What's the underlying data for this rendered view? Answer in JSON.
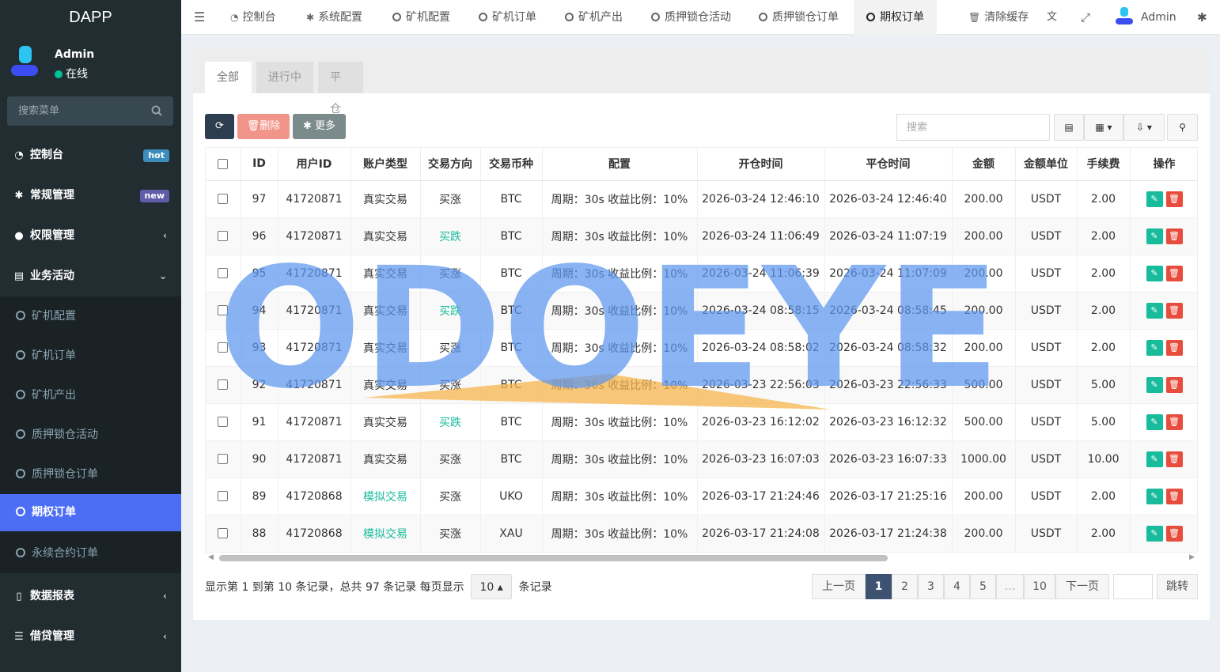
{
  "app": {
    "logo": "DAPP"
  },
  "user": {
    "name": "Admin",
    "status": "在线"
  },
  "menu_search": {
    "placeholder": "搜索菜单"
  },
  "sidebar": {
    "items": [
      {
        "label": "控制台",
        "badge": "hot",
        "badge_color": "#3c8dbc"
      },
      {
        "label": "常规管理",
        "badge": "new",
        "badge_color": "#605ca8"
      },
      {
        "label": "权限管理",
        "arrow": "‹"
      },
      {
        "label": "业务活动",
        "arrow": "⌄"
      },
      {
        "label": "数据报表",
        "arrow": "‹"
      },
      {
        "label": "借贷管理",
        "arrow": "‹"
      }
    ],
    "subitems": [
      {
        "label": "矿机配置"
      },
      {
        "label": "矿机订单"
      },
      {
        "label": "矿机产出"
      },
      {
        "label": "质押锁仓活动"
      },
      {
        "label": "质押锁仓订单"
      },
      {
        "label": "期权订单"
      },
      {
        "label": "永续合约订单"
      }
    ]
  },
  "topbar": {
    "tabs": [
      "控制台",
      "系统配置",
      "矿机配置",
      "矿机订单",
      "矿机产出",
      "质押锁仓活动",
      "质押锁仓订单",
      "期权订单"
    ],
    "clear_cache": "清除缓存",
    "admin": "Admin"
  },
  "content_tabs": [
    "全部",
    "进行中",
    "平仓"
  ],
  "toolbar": {
    "delete": "删除",
    "more": "更多",
    "search_placeholder": "搜索"
  },
  "table": {
    "headers": [
      "ID",
      "用户ID",
      "账户类型",
      "交易方向",
      "交易币种",
      "配置",
      "开仓时间",
      "平仓时间",
      "金额",
      "金额单位",
      "手续费",
      "操作"
    ],
    "rows": [
      [
        "97",
        "41720871",
        "真实交易",
        "买涨",
        "BTC",
        "周期：30s 收益比例：10%",
        "2026-03-24 12:46:10",
        "2026-03-24 12:46:40",
        "200.00",
        "USDT",
        "2.00"
      ],
      [
        "96",
        "41720871",
        "真实交易",
        "买跌",
        "BTC",
        "周期：30s 收益比例：10%",
        "2026-03-24 11:06:49",
        "2026-03-24 11:07:19",
        "200.00",
        "USDT",
        "2.00"
      ],
      [
        "95",
        "41720871",
        "真实交易",
        "买涨",
        "BTC",
        "周期：30s 收益比例：10%",
        "2026-03-24 11:06:39",
        "2026-03-24 11:07:09",
        "200.00",
        "USDT",
        "2.00"
      ],
      [
        "94",
        "41720871",
        "真实交易",
        "买跌",
        "BTC",
        "周期：30s 收益比例：10%",
        "2026-03-24 08:58:15",
        "2026-03-24 08:58:45",
        "200.00",
        "USDT",
        "2.00"
      ],
      [
        "93",
        "41720871",
        "真实交易",
        "买涨",
        "BTC",
        "周期：30s 收益比例：10%",
        "2026-03-24 08:58:02",
        "2026-03-24 08:58:32",
        "200.00",
        "USDT",
        "2.00"
      ],
      [
        "92",
        "41720871",
        "真实交易",
        "买涨",
        "BTC",
        "周期：30s 收益比例：10%",
        "2026-03-23 22:56:03",
        "2026-03-23 22:56:33",
        "500.00",
        "USDT",
        "5.00"
      ],
      [
        "91",
        "41720871",
        "真实交易",
        "买跌",
        "BTC",
        "周期：30s 收益比例：10%",
        "2026-03-23 16:12:02",
        "2026-03-23 16:12:32",
        "500.00",
        "USDT",
        "5.00"
      ],
      [
        "90",
        "41720871",
        "真实交易",
        "买涨",
        "BTC",
        "周期：30s 收益比例：10%",
        "2026-03-23 16:07:03",
        "2026-03-23 16:07:33",
        "1000.00",
        "USDT",
        "10.00"
      ],
      [
        "89",
        "41720868",
        "模拟交易",
        "买涨",
        "UKO",
        "周期：30s 收益比例：10%",
        "2026-03-17 21:24:46",
        "2026-03-17 21:25:16",
        "200.00",
        "USDT",
        "2.00"
      ],
      [
        "88",
        "41720868",
        "模拟交易",
        "买涨",
        "XAU",
        "周期：30s 收益比例：10%",
        "2026-03-17 21:24:08",
        "2026-03-17 21:24:38",
        "200.00",
        "USDT",
        "2.00"
      ]
    ]
  },
  "pagination": {
    "info_prefix": "显示第 1 到第 10 条记录，总共 97 条记录 每页显示",
    "page_size": "10",
    "info_suffix": "条记录",
    "prev": "上一页",
    "pages": [
      "1",
      "2",
      "3",
      "4",
      "5",
      "...",
      "10"
    ],
    "next": "下一页",
    "jump": "跳转"
  },
  "watermark": {
    "text": "ODOEYE"
  },
  "colors": {
    "accent": "#4c6ef5",
    "sidebar": "#222d32",
    "green": "#18bc9c",
    "danger": "#e74c3c",
    "pager_active": "#3c5270"
  }
}
